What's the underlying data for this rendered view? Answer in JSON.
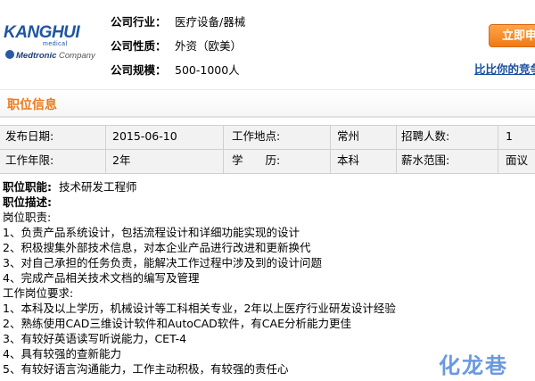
{
  "company": {
    "logo_name": "KANGHUI",
    "logo_sub": "medical",
    "logo_parent_brand": "Medtronic",
    "logo_parent_suffix": "Company",
    "fields": [
      {
        "label": "公司行业：",
        "value": "医疗设备/器械"
      },
      {
        "label": "公司性质：",
        "value": "外资（欧美）"
      },
      {
        "label": "公司规模：",
        "value": "500-1000人"
      }
    ],
    "apply_label": "立即申",
    "compare_label": "比比你的竞争"
  },
  "section": {
    "title": "职位信息"
  },
  "job_table": {
    "rows": [
      [
        {
          "label": "发布日期:",
          "value": "2015-06-10"
        },
        {
          "label": "工作地点:",
          "value": "常州"
        },
        {
          "label": "招聘人数:",
          "value": "1"
        }
      ],
      [
        {
          "label": "工作年限:",
          "value": "2年"
        },
        {
          "label": "学　　历:",
          "value": "本科"
        },
        {
          "label": "薪水范围:",
          "value": "面议"
        }
      ]
    ]
  },
  "description": {
    "position_label": "职位职能:",
    "position_value": "技术研发工程师",
    "desc_label": "职位描述:",
    "lines": [
      "岗位职责:",
      "1、负责产品系统设计，包括流程设计和详细功能实现的设计",
      "2、积极搜集外部技术信息，对本企业产品进行改进和更新换代",
      "3、对自己承担的任务负责，能解决工作过程中涉及到的设计问题",
      "4、完成产品相关技术文档的编写及管理",
      "工作岗位要求:",
      "1、本科及以上学历，机械设计等工科相关专业，2年以上医疗行业研发设计经验",
      "2、熟练使用CAD三维设计软件和AutoCAD软件，有CAE分析能力更佳",
      "3、有较好英语读写听说能力，CET-4",
      "4、具有较强的查新能力",
      "5、有较好语言沟通能力，工作主动积极，有较强的责任心"
    ]
  },
  "watermark": "化龙巷",
  "colors": {
    "accent_orange": "#ee7a1a",
    "link_blue": "#1a4fa0",
    "logo_blue": "#1e56a0"
  }
}
